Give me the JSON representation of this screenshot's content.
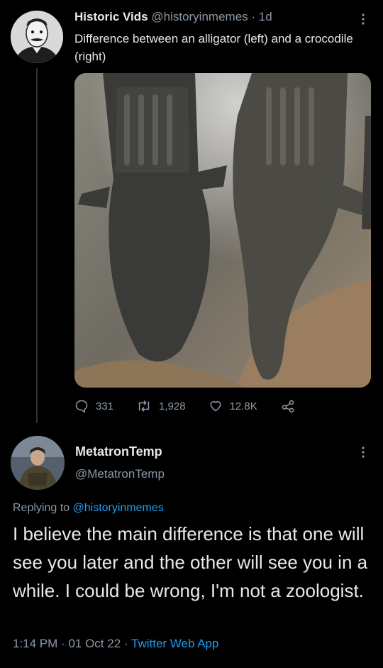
{
  "tweet": {
    "display_name": "Historic Vids",
    "handle": "@historyinmemes",
    "separator": "·",
    "age": "1d",
    "text": "Difference between an alligator (left) and a crocodile (right)",
    "image_alt_description": "Two crocodilians lying side by side",
    "replies": "331",
    "retweets": "1,928",
    "likes": "12.8K"
  },
  "reply": {
    "display_name": "MetatronTemp",
    "handle": "@MetatronTemp",
    "replying_prefix": "Replying to",
    "replying_to": "@historyinmemes",
    "text": "I believe the main difference is that one will see you later and the other will see you in a while. I could be wrong, I'm not a zoologist.",
    "time": "1:14 PM",
    "dot": "·",
    "date": "01 Oct 22",
    "client": "Twitter Web App"
  },
  "colors": {
    "background": "#000000",
    "text": "#e7e9ea",
    "secondary": "#8b98a5",
    "link": "#1d9bf0"
  },
  "icons": [
    "more-icon",
    "reply-icon",
    "retweet-icon",
    "like-icon",
    "share-icon"
  ]
}
